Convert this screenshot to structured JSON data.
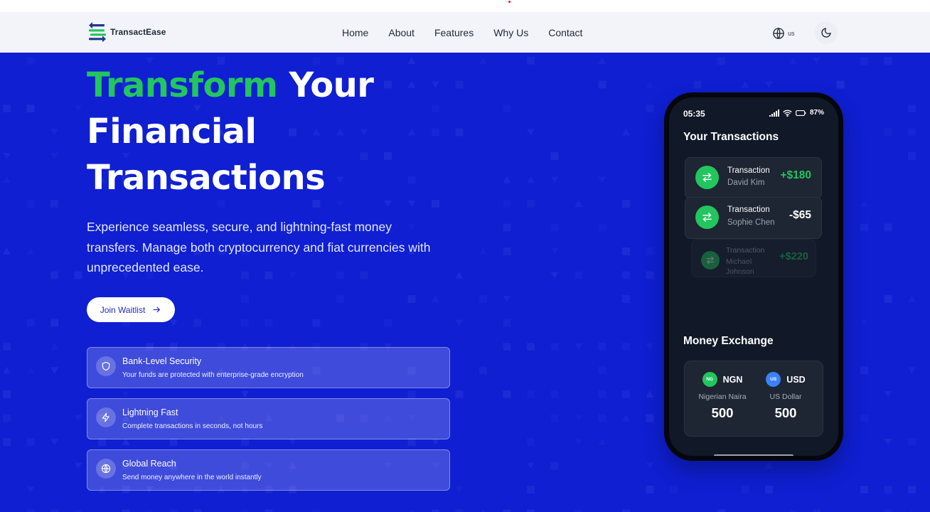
{
  "brand": {
    "name": "TransactEase"
  },
  "nav": {
    "links": [
      "Home",
      "About",
      "Features",
      "Why Us",
      "Contact"
    ],
    "language": "us",
    "icons": {
      "language": "globe-icon",
      "theme": "moon-icon"
    }
  },
  "hero": {
    "headline": {
      "highlight": "Transform",
      "line1_rest": " Your",
      "line2": "Financial",
      "line3": "Transactions"
    },
    "subtext": "Experience seamless, secure, and lightning-fast money transfers. Manage both cryptocurrency and fiat currencies with unprecedented ease.",
    "cta": {
      "label": "Join Waitlist",
      "icon": "arrow-right-icon"
    },
    "features": [
      {
        "title": "Bank-Level Security",
        "description": "Your funds are protected with enterprise-grade encryption",
        "icon": "shield-icon"
      },
      {
        "title": "Lightning Fast",
        "description": "Complete transactions in seconds, not hours",
        "icon": "lightning-icon"
      },
      {
        "title": "Global Reach",
        "description": "Send money anywhere in the world instantly",
        "icon": "globe-icon"
      }
    ]
  },
  "phone": {
    "status": {
      "time": "05:35",
      "battery": "87%"
    },
    "transactions_title": "Your Transactions",
    "transactions": [
      {
        "title": "Transaction",
        "name": "David Kim",
        "amount": "+$180"
      },
      {
        "title": "Transaction",
        "name": "Sophie Chen",
        "amount": "-$65"
      },
      {
        "title": "Transaction",
        "name": "Michael Johnson",
        "amount": "+$220"
      }
    ],
    "exchange_title": "Money Exchange",
    "exchange": {
      "from": {
        "code": "NGN",
        "badge": "NG",
        "name": "Nigerian Naira",
        "value": "500"
      },
      "to": {
        "code": "USD",
        "badge": "US",
        "name": "US Dollar",
        "value": "500"
      }
    }
  },
  "colors": {
    "hero_bg": "#0f1fd1",
    "accent_green": "#22c55e",
    "phone_screen": "#111827",
    "usd_badge": "#3b82f6"
  }
}
